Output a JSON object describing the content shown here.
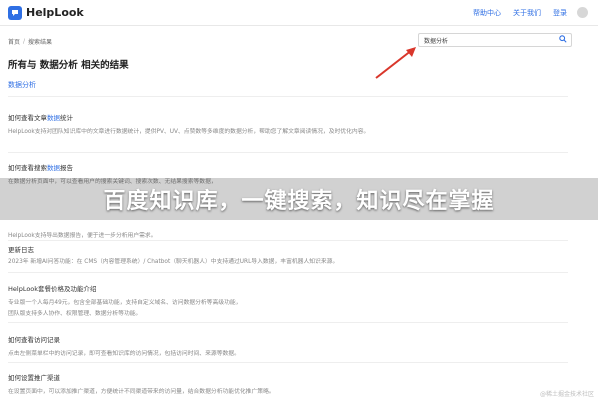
{
  "header": {
    "logo": "HelpLook",
    "nav": [
      "帮助中心",
      "关于我们",
      "登录"
    ]
  },
  "breadcrumb": [
    "首页",
    "搜索结果"
  ],
  "search": {
    "value": "数据分析"
  },
  "page_title": "所有与 数据分析 相关的结果",
  "filter_tag": "数据分析",
  "results": [
    {
      "title_pre": "如何查看文章",
      "title_hl": "数据",
      "title_post": "统计",
      "lines": [
        "HelpLook支持对团队知识库中的文章进行数据统计，提供PV、UV、点赞数等多维度的数据分析，帮助您了解文章阅读情况，及时优化内容。"
      ]
    },
    {
      "title_pre": "如何查看搜索",
      "title_hl": "数据",
      "title_post": "报告",
      "lines": [
        "在数据分析页面中，可以查看用户的搜索关键词、搜索次数、无结果搜索等数据，",
        "HelpLook支持导出数据报告，便于进一步分析用户需求。"
      ]
    },
    {
      "title_pre": "更新日志",
      "title_hl": "",
      "title_post": "",
      "lines": [
        "2023年 新增AI问答功能：在 CMS（内容管理系统）/ Chatbot（聊天机器人）中支持通过URL导入数据，丰富机器人知识来源。"
      ]
    },
    {
      "title_pre": "HelpLook套餐价格及功能介绍",
      "title_hl": "",
      "title_post": "",
      "lines": [
        "专业版一个人每月49元，包含全部基础功能，支持自定义域名、访问数据分析等高级功能，",
        "团队版支持多人协作、权限管理、数据分析等功能。"
      ]
    },
    {
      "title_pre": "如何查看访问记录",
      "title_hl": "",
      "title_post": "",
      "lines": [
        "点击左侧菜单栏中的访问记录，即可查看知识库的访问情况，包括访问时间、来源等数据。"
      ]
    },
    {
      "title_pre": "如何设置推广渠道",
      "title_hl": "",
      "title_post": "",
      "lines": [
        "在设置页面中，可以添加推广渠道，方便统计不同渠道带来的访问量，结合数据分析功能优化推广策略。"
      ]
    }
  ],
  "banner": "百度知识库，一键搜索，知识尽在掌握",
  "watermark": "@稀土掘金技术社区",
  "colors": {
    "accent": "#2f6fe4",
    "arrow": "#d9362b"
  }
}
